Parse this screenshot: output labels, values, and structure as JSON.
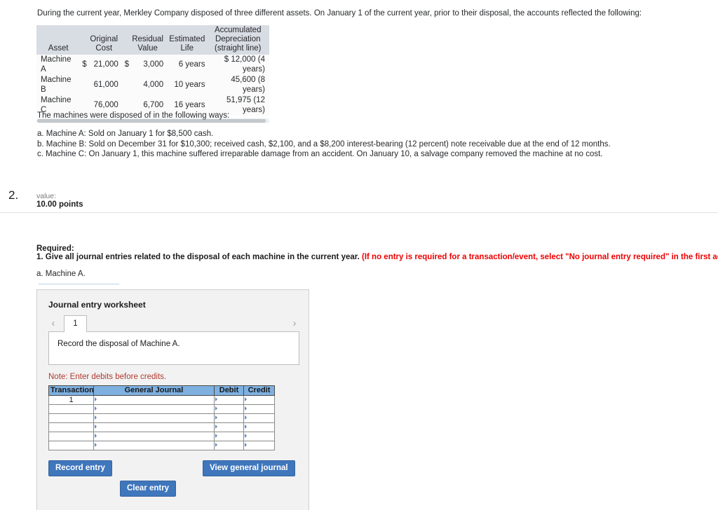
{
  "intro": {
    "paragraph": "During the current year, Merkley Company disposed of three different assets. On January 1 of the current year, prior to their disposal, the accounts reflected the following:"
  },
  "asset_table": {
    "headers": {
      "asset": "Asset",
      "original_cost_line1": "Original",
      "original_cost_line2": "Cost",
      "residual_value_line1": "Residual",
      "residual_value_line2": "Value",
      "estimated_life_line1": "Estimated",
      "estimated_life_line2": "Life",
      "accum_dep_line1": "Accumulated",
      "accum_dep_line2": "Depreciation",
      "accum_dep_line3": "(straight line)"
    },
    "rows": [
      {
        "asset": "Machine A",
        "cost_symbol": "$",
        "cost": "21,000",
        "residual_symbol": "$",
        "residual": "3,000",
        "life": "6 years",
        "accum_symbol": "$",
        "accum": "12,000 (4 years)"
      },
      {
        "asset": "Machine B",
        "cost_symbol": "",
        "cost": "61,000",
        "residual_symbol": "",
        "residual": "4,000",
        "life": "10 years",
        "accum_symbol": "",
        "accum": "45,600 (8 years)"
      },
      {
        "asset": "Machine C",
        "cost_symbol": "",
        "cost": "76,000",
        "residual_symbol": "",
        "residual": "6,700",
        "life": "16 years",
        "accum_symbol": "",
        "accum": "51,975 (12 years)"
      }
    ]
  },
  "disposal": {
    "heading": "The machines were disposed of in the following ways:",
    "items": [
      "a. Machine A: Sold on January 1 for $8,500 cash.",
      "b. Machine B: Sold on December 31 for $10,300; received cash, $2,100, and a $8,200 interest-bearing (12 percent) note receivable due at the end of 12 months.",
      "c. Machine C: On January 1, this machine suffered irreparable damage from an accident. On January 10, a salvage company removed the machine at no cost."
    ]
  },
  "question": {
    "number": "2.",
    "value_label": "value:",
    "points": "10.00 points"
  },
  "required": {
    "label": "Required:",
    "line_black": "1. Give all journal entries related to the disposal of each machine in the current year.",
    "line_red": "(If no entry is required for a transaction/event, select \"No journal entry required\" in the first account field.)",
    "part_a": "a. Machine A."
  },
  "journal_panel": {
    "title": "Journal entry worksheet",
    "prev_arrow": "‹",
    "next_arrow": "›",
    "tab_label": "1",
    "description": "Record the disposal of Machine A.",
    "note": "Note: Enter debits before credits.",
    "table": {
      "headers": [
        "Transaction",
        "General Journal",
        "Debit",
        "Credit"
      ],
      "rows": [
        {
          "transaction": "1",
          "general_journal": "",
          "debit": "",
          "credit": ""
        },
        {
          "transaction": "",
          "general_journal": "",
          "debit": "",
          "credit": ""
        },
        {
          "transaction": "",
          "general_journal": "",
          "debit": "",
          "credit": ""
        },
        {
          "transaction": "",
          "general_journal": "",
          "debit": "",
          "credit": ""
        },
        {
          "transaction": "",
          "general_journal": "",
          "debit": "",
          "credit": ""
        },
        {
          "transaction": "",
          "general_journal": "",
          "debit": "",
          "credit": ""
        }
      ]
    },
    "buttons": {
      "record": "Record entry",
      "clear": "Clear entry",
      "view": "View general journal"
    }
  },
  "colors": {
    "button_blue": "#3f76bc",
    "table_header_blue": "#7eb0e0",
    "asset_header_gray": "#d8dce3",
    "panel_gray": "#f2f2f2",
    "note_red": "#b03a2e",
    "required_red": "#ee0000"
  }
}
